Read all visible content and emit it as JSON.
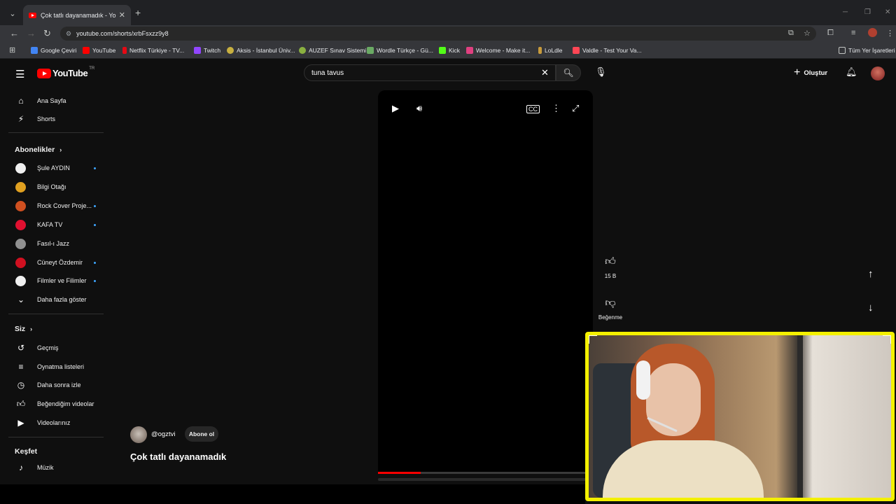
{
  "browser": {
    "tab_title": "Çok tatlı dayanamadık - YouTube",
    "url": "youtube.com/shorts/xrbFsxzz9y8",
    "bookmarks": [
      {
        "label": "Google Çeviri",
        "color": "#4285f4"
      },
      {
        "label": "YouTube",
        "color": "#ff0000"
      },
      {
        "label": "Netflix Türkiye - TV...",
        "color": "#e50914"
      },
      {
        "label": "Twitch",
        "color": "#9146ff"
      },
      {
        "label": "Aksis - İstanbul Üniv...",
        "color": "#c8b040"
      },
      {
        "label": "AUZEF Sınav Sistemi",
        "color": "#8ab040"
      },
      {
        "label": "Wordle Türkçe - Gü...",
        "color": "#6aaa64"
      },
      {
        "label": "Kick",
        "color": "#53fc18"
      },
      {
        "label": "Welcome - Make it...",
        "color": "#e04080"
      },
      {
        "label": "LoLdle",
        "color": "#c89b3c"
      },
      {
        "label": "Valdle - Test Your Va...",
        "color": "#ff4655"
      }
    ],
    "all_bookmarks": "Tüm Yer İşaretleri"
  },
  "youtube": {
    "logo_text": "YouTube",
    "country_code": "TR",
    "search_query": "tuna tavus",
    "create_label": "Oluştur",
    "sidebar": {
      "main": [
        {
          "label": "Ana Sayfa",
          "icon": "home-icon"
        },
        {
          "label": "Shorts",
          "icon": "shorts-icon"
        }
      ],
      "subscriptions_title": "Abonelikler",
      "subscriptions": [
        {
          "label": "Şule AYDIN",
          "color": "#f0f0f0",
          "new": true
        },
        {
          "label": "Bilgi Otağı",
          "color": "#e0a020",
          "new": false
        },
        {
          "label": "Rock Cover Proje...",
          "color": "#d05020",
          "new": true
        },
        {
          "label": "KAFA TV",
          "color": "#e01030",
          "new": true
        },
        {
          "label": "Fasıl-ı Jazz",
          "color": "#909090",
          "new": false
        },
        {
          "label": "Cüneyt Özdemir",
          "color": "#d01020",
          "new": true
        },
        {
          "label": "Filmler ve Filimler",
          "color": "#f0f0f0",
          "new": true
        }
      ],
      "show_more": "Daha fazla göster",
      "you_title": "Siz",
      "you_items": [
        {
          "label": "Geçmiş",
          "icon": "history-icon"
        },
        {
          "label": "Oynatma listeleri",
          "icon": "playlist-icon"
        },
        {
          "label": "Daha sonra izle",
          "icon": "watch-later-icon"
        },
        {
          "label": "Beğendiğim videolar",
          "icon": "liked-videos-icon"
        },
        {
          "label": "Videolarınız",
          "icon": "your-videos-icon"
        }
      ],
      "explore_title": "Keşfet",
      "explore_items": [
        {
          "label": "Müzik",
          "icon": "music-icon"
        }
      ]
    },
    "short": {
      "channel": "@ogztvi",
      "subscribe_label": "Abone ol",
      "title": "Çok tatlı dayanamadık",
      "progress": 0.2,
      "likes": "15 B",
      "dislike_label": "Beğenme"
    }
  }
}
